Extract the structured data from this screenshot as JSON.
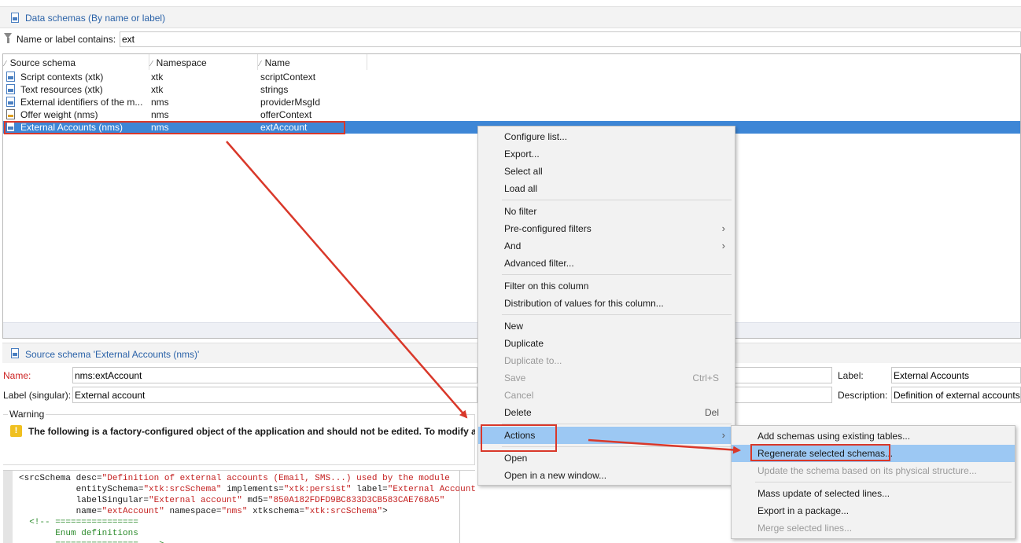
{
  "header": {
    "title": "Data schemas (By name or label)"
  },
  "filter": {
    "label": "Name or label contains:",
    "value": "ext"
  },
  "list": {
    "columns": [
      "Source schema",
      "Namespace",
      "Name"
    ],
    "rows": [
      {
        "source": "Script contexts (xtk)",
        "namespace": "xtk",
        "name": "scriptContext",
        "icon": "schema-icon"
      },
      {
        "source": "Text resources (xtk)",
        "namespace": "xtk",
        "name": "strings",
        "icon": "schema-icon"
      },
      {
        "source": "External identifiers of the m...",
        "namespace": "nms",
        "name": "providerMsgId",
        "icon": "schema-icon"
      },
      {
        "source": "Offer weight (nms)",
        "namespace": "nms",
        "name": "offerContext",
        "icon": "schema-alt-icon"
      },
      {
        "source": "External Accounts (nms)",
        "namespace": "nms",
        "name": "extAccount",
        "icon": "schema-icon",
        "selected": true
      }
    ]
  },
  "detail": {
    "title": "Source schema 'External Accounts (nms)'",
    "name_label": "Name:",
    "name_value": "nms:extAccount",
    "label_singular_label": "Label (singular):",
    "label_singular_value": "External account",
    "label_label": "Label:",
    "label_value": "External Accounts",
    "description_label": "Description:",
    "description_value": "Definition of external accounts",
    "warning_legend": "Warning",
    "warning_text": "The following is a factory-configured object of the application and should not be edited. To modify a fac"
  },
  "code": {
    "lines": [
      [
        {
          "t": "tag",
          "v": "<srcSchema "
        },
        {
          "t": "attr",
          "v": "desc="
        },
        {
          "t": "val",
          "v": "\"Definition of external accounts (Email, SMS...) used by the module"
        }
      ],
      [
        {
          "t": "attr",
          "v": "           entitySchema="
        },
        {
          "t": "val",
          "v": "\"xtk:srcSchema\""
        },
        {
          "t": "attr",
          "v": " implements="
        },
        {
          "t": "val",
          "v": "\"xtk:persist\""
        },
        {
          "t": "attr",
          "v": " label="
        },
        {
          "t": "val",
          "v": "\"External Accounts\""
        }
      ],
      [
        {
          "t": "attr",
          "v": "           labelSingular="
        },
        {
          "t": "val",
          "v": "\"External account\""
        },
        {
          "t": "attr",
          "v": " md5="
        },
        {
          "t": "val",
          "v": "\"850A182FDFD9BC833D3CB583CAE768A5\""
        }
      ],
      [
        {
          "t": "attr",
          "v": "           name="
        },
        {
          "t": "val",
          "v": "\"extAccount\""
        },
        {
          "t": "attr",
          "v": " namespace="
        },
        {
          "t": "val",
          "v": "\"nms\""
        },
        {
          "t": "attr",
          "v": " xtkschema="
        },
        {
          "t": "val",
          "v": "\"xtk:srcSchema\""
        },
        {
          "t": "tag",
          "v": ">"
        }
      ],
      [
        {
          "t": "cm",
          "v": "  <!-- ================"
        }
      ],
      [
        {
          "t": "cm",
          "v": "       Enum definitions"
        }
      ],
      [
        {
          "t": "cm",
          "v": "       ================  -->"
        }
      ]
    ]
  },
  "context_menu": {
    "items": [
      {
        "label": "Configure list..."
      },
      {
        "label": "Export..."
      },
      {
        "label": "Select all"
      },
      {
        "label": "Load all"
      },
      {
        "sep": true
      },
      {
        "label": "No filter"
      },
      {
        "label": "Pre-configured filters",
        "submenu": true
      },
      {
        "label": "And",
        "submenu": true
      },
      {
        "label": "Advanced filter..."
      },
      {
        "sep": true
      },
      {
        "label": "Filter on this column"
      },
      {
        "label": "Distribution of values for this column..."
      },
      {
        "sep": true
      },
      {
        "label": "New"
      },
      {
        "label": "Duplicate"
      },
      {
        "label": "Duplicate to...",
        "disabled": true
      },
      {
        "label": "Save",
        "shortcut": "Ctrl+S",
        "disabled": true
      },
      {
        "label": "Cancel",
        "disabled": true
      },
      {
        "label": "Delete",
        "shortcut": "Del"
      },
      {
        "sep": true
      },
      {
        "label": "Actions",
        "submenu": true,
        "highlighted": true
      },
      {
        "sep": true
      },
      {
        "label": "Open"
      },
      {
        "label": "Open in a new window..."
      }
    ]
  },
  "submenu": {
    "items": [
      {
        "label": "Add schemas using existing tables..."
      },
      {
        "label": "Regenerate selected schemas...",
        "highlighted": true
      },
      {
        "label": "Update the schema based on its physical structure...",
        "disabled": true
      },
      {
        "sep": true
      },
      {
        "label": "Mass update of selected lines..."
      },
      {
        "label": "Export in a package..."
      },
      {
        "label": "Merge selected lines...",
        "disabled": true
      }
    ]
  },
  "colors": {
    "selection": "#3d86d6",
    "menu_highlight": "#9cc8f3",
    "annotation_red": "#d9382a",
    "title_blue": "#2a62a8"
  }
}
